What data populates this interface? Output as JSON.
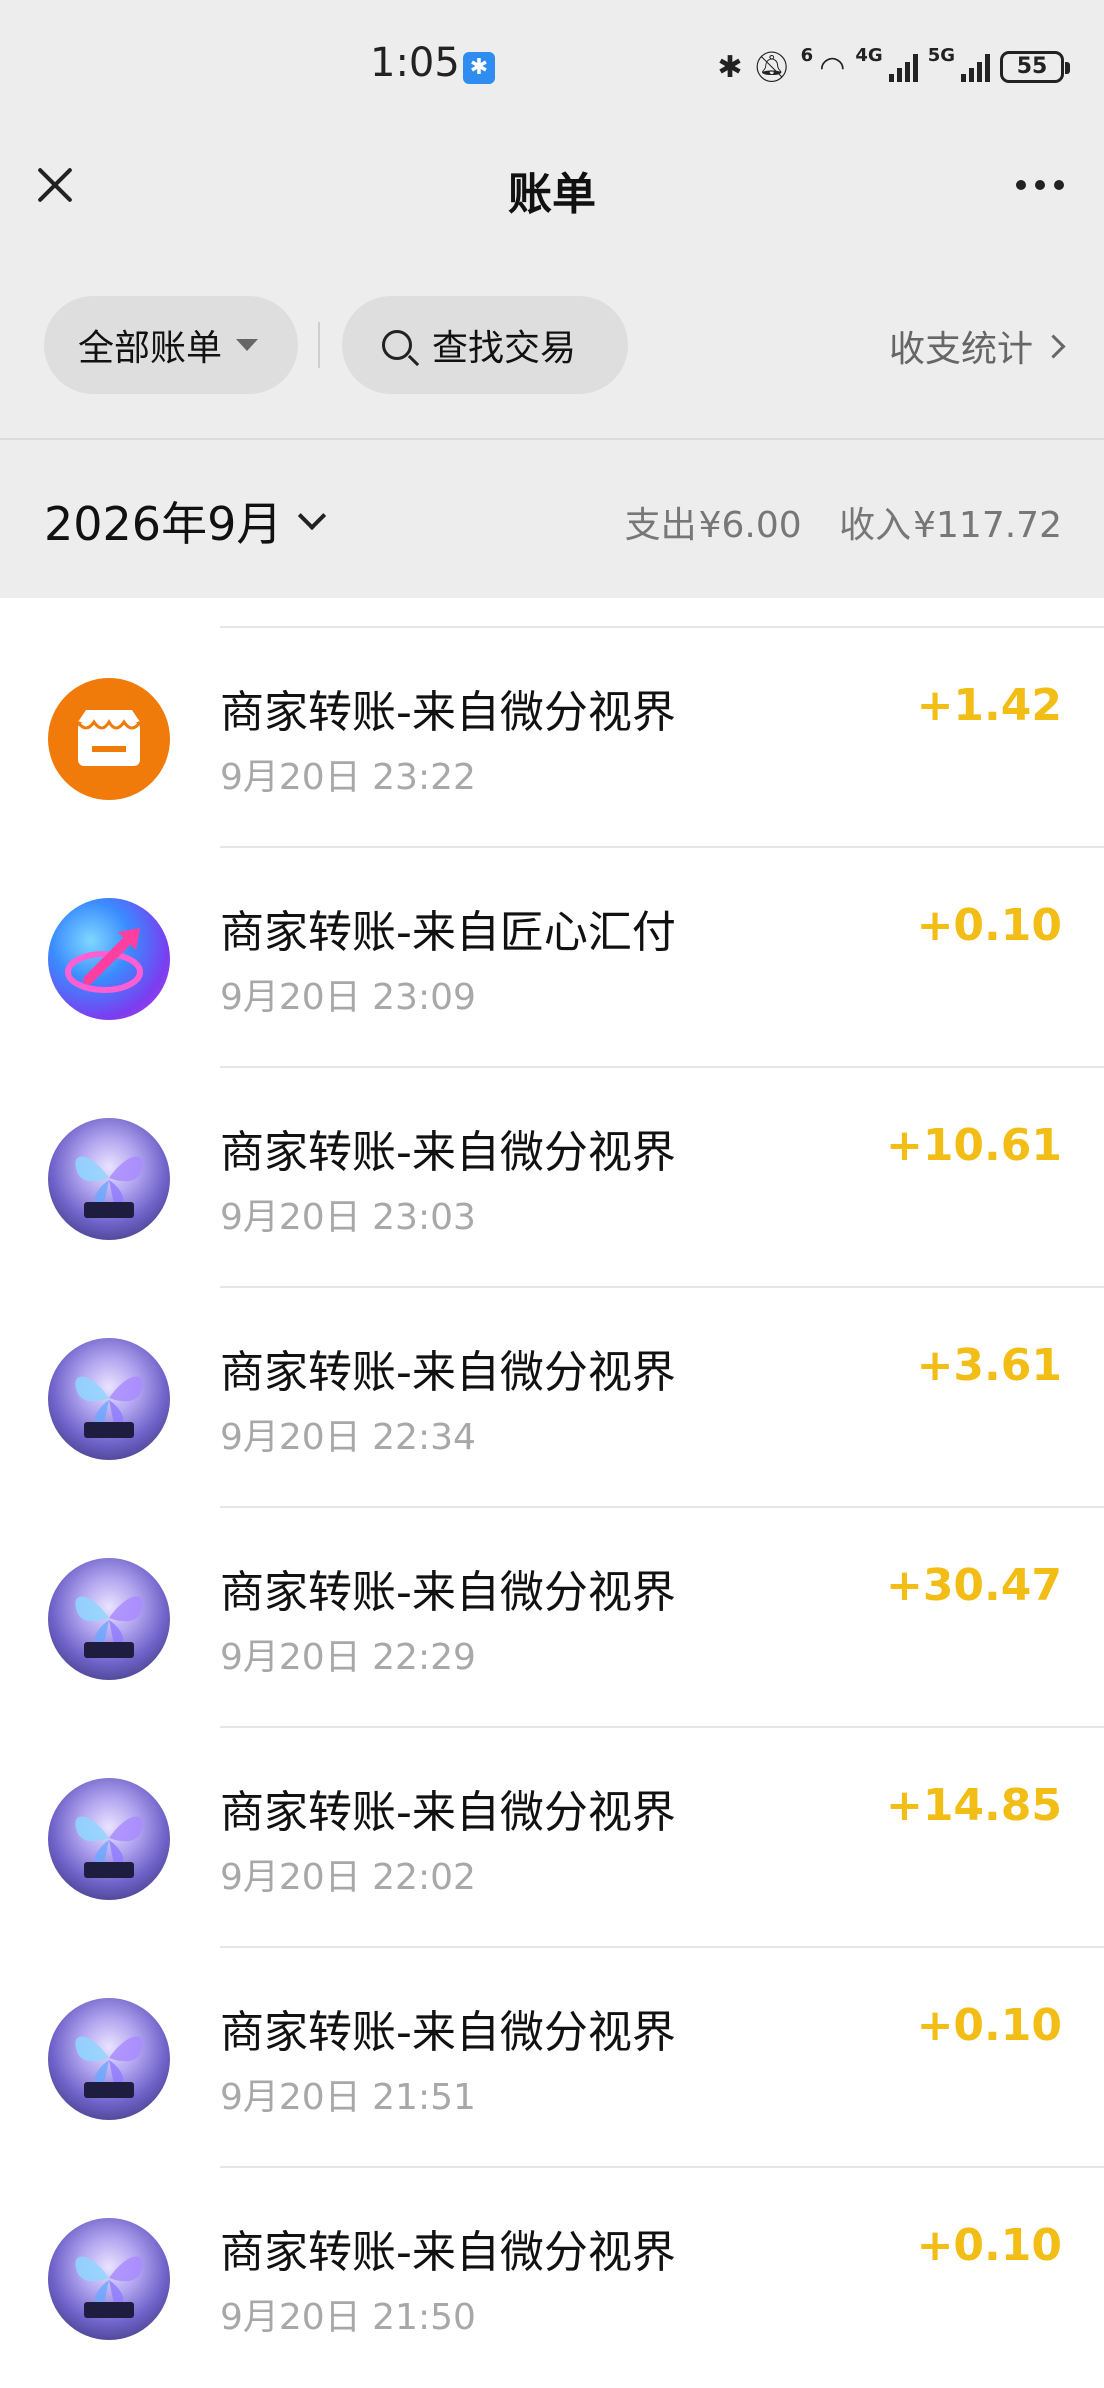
{
  "status_bar": {
    "time": "1:05",
    "network_1": "6",
    "network_2": "4G",
    "network_3": "5G",
    "battery": "55"
  },
  "header": {
    "title": "账单"
  },
  "filters": {
    "all_bills": "全部账单",
    "search": "查找交易",
    "stats": "收支统计"
  },
  "month_bar": {
    "month": "2026年9月",
    "expense_label": "支出",
    "expense_value": "¥6.00",
    "income_label": "收入",
    "income_value": "¥117.72"
  },
  "transactions": [
    {
      "name": "商家转账-来自微分视界",
      "time": "9月20日 23:22",
      "amount": "+1.42",
      "avatar": "shop-icon"
    },
    {
      "name": "商家转账-来自匠心汇付",
      "time": "9月20日 23:09",
      "amount": "+0.10",
      "avatar": "arrow-logo"
    },
    {
      "name": "商家转账-来自微分视界",
      "time": "9月20日 23:03",
      "amount": "+10.61",
      "avatar": "butterfly-image"
    },
    {
      "name": "商家转账-来自微分视界",
      "time": "9月20日 22:34",
      "amount": "+3.61",
      "avatar": "butterfly-image"
    },
    {
      "name": "商家转账-来自微分视界",
      "time": "9月20日 22:29",
      "amount": "+30.47",
      "avatar": "butterfly-image"
    },
    {
      "name": "商家转账-来自微分视界",
      "time": "9月20日 22:02",
      "amount": "+14.85",
      "avatar": "butterfly-image"
    },
    {
      "name": "商家转账-来自微分视界",
      "time": "9月20日 21:51",
      "amount": "+0.10",
      "avatar": "butterfly-image"
    },
    {
      "name": "商家转账-来自微分视界",
      "time": "9月20日 21:50",
      "amount": "+0.10",
      "avatar": "butterfly-image"
    }
  ],
  "colors": {
    "income_amount": "#f2bd14",
    "header_bg": "#ededed",
    "shop_avatar": "#f07a0a"
  }
}
